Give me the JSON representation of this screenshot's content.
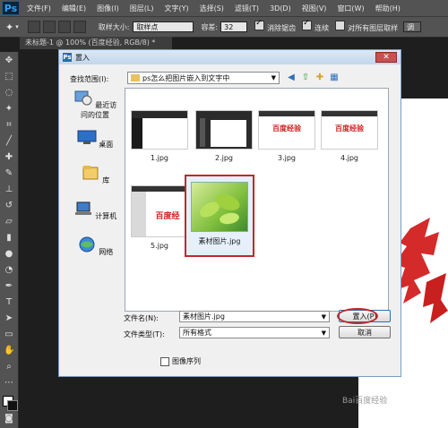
{
  "app": {
    "logo": "Ps",
    "menu": [
      "文件(F)",
      "编辑(E)",
      "图像(I)",
      "图层(L)",
      "文字(Y)",
      "选择(S)",
      "滤镜(T)",
      "3D(D)",
      "视图(V)",
      "窗口(W)",
      "帮助(H)"
    ]
  },
  "options_bar": {
    "sample_size_label": "取样大小:",
    "sample_size_value": "取样点",
    "tolerance_label": "容差:",
    "tolerance_value": "32",
    "antialias_label": "消除锯齿",
    "contiguous_label": "连续",
    "all_layers_label": "对所有图层取样",
    "adjust_label": "调"
  },
  "document_tab": "未标题-1 @ 100% (百度经验, RGB/8) *",
  "dialog": {
    "title": "置入",
    "close_label": "✕",
    "look_in_label": "查找范围(I):",
    "look_in_value": "ps怎么把图片嵌入到文字中",
    "places": [
      {
        "label": "最近访问的位置",
        "icon": "recent-places-icon"
      },
      {
        "label": "桌面",
        "icon": "desktop-icon"
      },
      {
        "label": "库",
        "icon": "libraries-icon"
      },
      {
        "label": "计算机",
        "icon": "computer-icon"
      },
      {
        "label": "网络",
        "icon": "network-icon"
      }
    ],
    "files": [
      {
        "name": "1.jpg",
        "thumb_text": ""
      },
      {
        "name": "2.jpg",
        "thumb_text": ""
      },
      {
        "name": "3.jpg",
        "thumb_text": "百度经验"
      },
      {
        "name": "4.jpg",
        "thumb_text": "百度经验"
      },
      {
        "name": "5.jpg",
        "thumb_text": "百度经"
      },
      {
        "name": "素材图片.jpg",
        "thumb_text": ""
      }
    ],
    "filename_label": "文件名(N):",
    "filename_value": "素材图片.jpg",
    "filetype_label": "文件类型(T):",
    "filetype_value": "所有格式",
    "place_button": "置入(P)",
    "cancel_button": "取消",
    "image_sequence_label": "图像序列"
  },
  "canvas": {
    "watermark": "Bai百度经验"
  },
  "colors": {
    "accent_red": "#c0282d",
    "ps_blue": "#2fa3f0"
  }
}
